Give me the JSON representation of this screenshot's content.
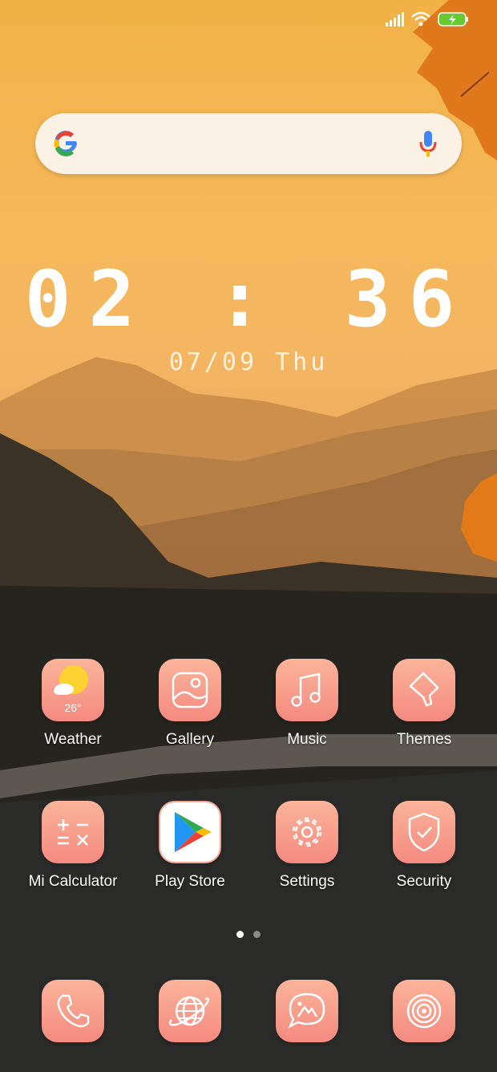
{
  "status_bar": {
    "icons": [
      "signal-icon",
      "wifi-icon",
      "battery-charging-icon"
    ]
  },
  "search_bar": {
    "logo": "google-logo-icon",
    "mic": "mic-icon"
  },
  "clock": {
    "time": "02 : 36",
    "date": "07/09  Thu"
  },
  "apps_row1": [
    {
      "label": "Weather",
      "icon": "weather-icon",
      "temp": "26°"
    },
    {
      "label": "Gallery",
      "icon": "gallery-icon"
    },
    {
      "label": "Music",
      "icon": "music-icon"
    },
    {
      "label": "Themes",
      "icon": "themes-icon"
    }
  ],
  "apps_row2": [
    {
      "label": "Mi Calculator",
      "icon": "calculator-icon"
    },
    {
      "label": "Play Store",
      "icon": "play-store-icon"
    },
    {
      "label": "Settings",
      "icon": "settings-icon"
    },
    {
      "label": "Security",
      "icon": "security-icon"
    }
  ],
  "page_indicator": {
    "pages": 2,
    "current": 1
  },
  "dock": [
    {
      "icon": "phone-icon"
    },
    {
      "icon": "browser-icon"
    },
    {
      "icon": "messages-icon"
    },
    {
      "icon": "camera-icon"
    }
  ],
  "colors": {
    "icon_top": "#fbb49a",
    "icon_bottom": "#f48a80",
    "sky": "#f2b247"
  }
}
